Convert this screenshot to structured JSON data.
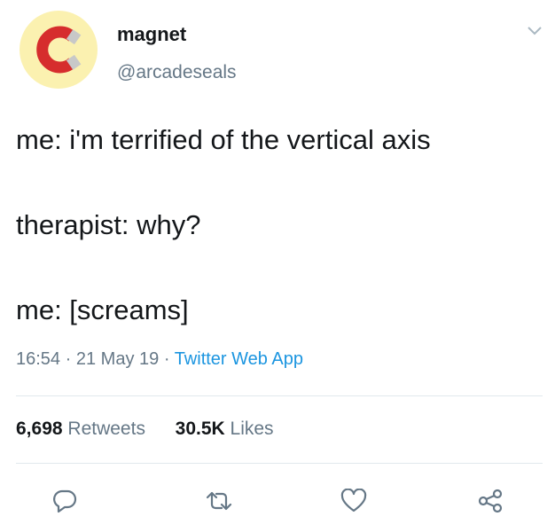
{
  "user": {
    "display_name": "magnet",
    "handle": "@arcadeseals",
    "avatar_icon": "magnet-icon",
    "avatar_bg": "#fbf1b0"
  },
  "tweet": {
    "lines": [
      "me: i'm terrified of the vertical axis",
      "therapist: why?",
      "me: [screams]"
    ]
  },
  "meta": {
    "time": "16:54",
    "date": "21 May 19",
    "separator": "·",
    "source": "Twitter Web App"
  },
  "stats": {
    "retweets_count": "6,698",
    "retweets_label": "Retweets",
    "likes_count": "30.5K",
    "likes_label": "Likes"
  },
  "actions": {
    "reply_icon": "reply-icon",
    "retweet_icon": "retweet-icon",
    "like_icon": "heart-icon",
    "share_icon": "share-icon"
  },
  "colors": {
    "text": "#14171a",
    "secondary": "#657786",
    "link": "#1b95e0",
    "divider": "#e1e8ed"
  }
}
